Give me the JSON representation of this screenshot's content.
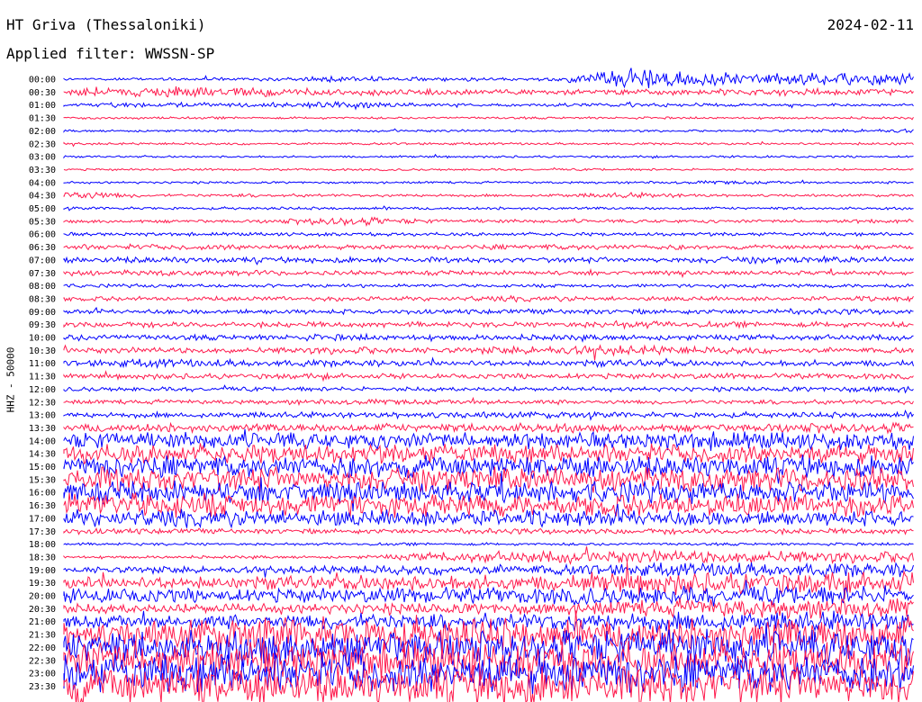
{
  "header": {
    "station_title": "HT Griva (Thessaloniki)",
    "date": "2024-02-11",
    "filter_label": "Applied filter:",
    "filter_value": "WWSSN-SP"
  },
  "channel_label": "HHZ - 50000",
  "colors": {
    "even_trace": "#0000ff",
    "odd_trace": "#ff1a4d",
    "background": "#ffffff",
    "text": "#000000"
  },
  "chart_data": {
    "type": "heatmap",
    "description_of_encoding": "helicorder: one trace row per 30 minutes; values are relative peak activity (0-1) along each row in 10 time segments",
    "ylabel": "HHZ - 50000",
    "row_labels": [
      "00:00",
      "00:30",
      "01:00",
      "01:30",
      "02:00",
      "02:30",
      "03:00",
      "03:30",
      "04:00",
      "04:30",
      "05:00",
      "05:30",
      "06:00",
      "06:30",
      "07:00",
      "07:30",
      "08:00",
      "08:30",
      "09:00",
      "09:30",
      "10:00",
      "10:30",
      "11:00",
      "11:30",
      "12:00",
      "12:30",
      "13:00",
      "13:30",
      "14:00",
      "14:30",
      "15:00",
      "15:30",
      "16:00",
      "16:30",
      "17:00",
      "17:30",
      "18:00",
      "18:30",
      "19:00",
      "19:30",
      "20:00",
      "20:30",
      "21:00",
      "21:30",
      "22:00",
      "22:30",
      "23:00",
      "23:30"
    ],
    "activity": [
      [
        0.15,
        0.15,
        0.2,
        0.3,
        0.25,
        0.2,
        0.7,
        0.5,
        0.5,
        0.5
      ],
      [
        0.4,
        0.45,
        0.4,
        0.35,
        0.3,
        0.3,
        0.3,
        0.35,
        0.35,
        0.3
      ],
      [
        0.2,
        0.3,
        0.25,
        0.4,
        0.15,
        0.15,
        0.3,
        0.2,
        0.15,
        0.15
      ],
      [
        0.1,
        0.1,
        0.1,
        0.1,
        0.1,
        0.1,
        0.1,
        0.1,
        0.1,
        0.1
      ],
      [
        0.1,
        0.1,
        0.1,
        0.1,
        0.1,
        0.1,
        0.1,
        0.1,
        0.15,
        0.25
      ],
      [
        0.1,
        0.1,
        0.1,
        0.1,
        0.1,
        0.1,
        0.1,
        0.1,
        0.1,
        0.2
      ],
      [
        0.08,
        0.08,
        0.08,
        0.08,
        0.08,
        0.08,
        0.08,
        0.08,
        0.08,
        0.08
      ],
      [
        0.08,
        0.08,
        0.08,
        0.08,
        0.08,
        0.08,
        0.1,
        0.08,
        0.08,
        0.08
      ],
      [
        0.1,
        0.1,
        0.1,
        0.1,
        0.1,
        0.1,
        0.1,
        0.2,
        0.1,
        0.1
      ],
      [
        0.5,
        0.15,
        0.2,
        0.15,
        0.15,
        0.15,
        0.3,
        0.15,
        0.15,
        0.15
      ],
      [
        0.15,
        0.15,
        0.15,
        0.15,
        0.15,
        0.15,
        0.15,
        0.15,
        0.15,
        0.15
      ],
      [
        0.2,
        0.2,
        0.2,
        0.45,
        0.2,
        0.2,
        0.2,
        0.2,
        0.2,
        0.25
      ],
      [
        0.2,
        0.2,
        0.2,
        0.2,
        0.2,
        0.2,
        0.2,
        0.2,
        0.2,
        0.2
      ],
      [
        0.3,
        0.3,
        0.3,
        0.25,
        0.25,
        0.3,
        0.3,
        0.25,
        0.25,
        0.25
      ],
      [
        0.3,
        0.35,
        0.3,
        0.3,
        0.3,
        0.3,
        0.3,
        0.35,
        0.35,
        0.3
      ],
      [
        0.3,
        0.3,
        0.3,
        0.25,
        0.25,
        0.25,
        0.25,
        0.25,
        0.25,
        0.25
      ],
      [
        0.2,
        0.2,
        0.2,
        0.2,
        0.2,
        0.2,
        0.2,
        0.2,
        0.2,
        0.25
      ],
      [
        0.25,
        0.25,
        0.25,
        0.25,
        0.25,
        0.3,
        0.25,
        0.25,
        0.25,
        0.3
      ],
      [
        0.25,
        0.25,
        0.25,
        0.25,
        0.25,
        0.3,
        0.3,
        0.3,
        0.3,
        0.3
      ],
      [
        0.3,
        0.3,
        0.3,
        0.3,
        0.3,
        0.3,
        0.4,
        0.3,
        0.3,
        0.3
      ],
      [
        0.35,
        0.3,
        0.3,
        0.35,
        0.3,
        0.3,
        0.3,
        0.3,
        0.3,
        0.3
      ],
      [
        0.3,
        0.3,
        0.3,
        0.4,
        0.3,
        0.4,
        0.45,
        0.35,
        0.3,
        0.3
      ],
      [
        0.3,
        0.4,
        0.35,
        0.35,
        0.3,
        0.3,
        0.4,
        0.3,
        0.35,
        0.35
      ],
      [
        0.25,
        0.3,
        0.3,
        0.3,
        0.25,
        0.3,
        0.3,
        0.3,
        0.3,
        0.3
      ],
      [
        0.25,
        0.25,
        0.25,
        0.25,
        0.25,
        0.25,
        0.25,
        0.25,
        0.3,
        0.35
      ],
      [
        0.25,
        0.25,
        0.25,
        0.3,
        0.25,
        0.25,
        0.25,
        0.25,
        0.25,
        0.25
      ],
      [
        0.3,
        0.3,
        0.3,
        0.3,
        0.35,
        0.35,
        0.3,
        0.3,
        0.3,
        0.3
      ],
      [
        0.4,
        0.4,
        0.4,
        0.4,
        0.4,
        0.45,
        0.4,
        0.4,
        0.45,
        0.45
      ],
      [
        0.6,
        0.6,
        0.6,
        0.6,
        0.6,
        0.6,
        0.6,
        0.65,
        0.6,
        0.6
      ],
      [
        0.65,
        0.65,
        0.65,
        0.65,
        0.65,
        0.65,
        0.65,
        0.65,
        0.65,
        0.65
      ],
      [
        0.7,
        0.7,
        0.7,
        0.7,
        0.7,
        0.7,
        0.7,
        0.7,
        0.7,
        0.7
      ],
      [
        0.75,
        0.75,
        0.75,
        0.75,
        0.75,
        0.75,
        0.75,
        0.75,
        0.75,
        0.75
      ],
      [
        0.7,
        0.7,
        0.7,
        0.7,
        0.7,
        0.7,
        0.7,
        0.7,
        0.7,
        0.7
      ],
      [
        0.75,
        0.8,
        0.7,
        0.7,
        0.7,
        0.7,
        0.7,
        0.7,
        0.7,
        0.7
      ],
      [
        0.6,
        0.6,
        0.6,
        0.6,
        0.6,
        0.6,
        0.6,
        0.55,
        0.55,
        0.55
      ],
      [
        0.3,
        0.3,
        0.3,
        0.3,
        0.3,
        0.3,
        0.3,
        0.3,
        0.3,
        0.3
      ],
      [
        0.15,
        0.15,
        0.15,
        0.15,
        0.15,
        0.15,
        0.15,
        0.15,
        0.15,
        0.15
      ],
      [
        0.15,
        0.15,
        0.15,
        0.15,
        0.45,
        0.5,
        0.5,
        0.5,
        0.5,
        0.5
      ],
      [
        0.35,
        0.35,
        0.35,
        0.4,
        0.45,
        0.45,
        0.5,
        0.55,
        0.55,
        0.55
      ],
      [
        0.5,
        0.5,
        0.55,
        0.6,
        0.6,
        0.6,
        0.7,
        0.7,
        0.7,
        0.7
      ],
      [
        0.55,
        0.55,
        0.55,
        0.55,
        0.6,
        0.6,
        0.65,
        0.65,
        0.65,
        0.65
      ],
      [
        0.45,
        0.45,
        0.45,
        0.45,
        0.5,
        0.5,
        0.6,
        0.65,
        0.65,
        0.65
      ],
      [
        0.5,
        0.5,
        0.55,
        0.6,
        0.6,
        0.6,
        0.65,
        0.65,
        0.65,
        0.7
      ],
      [
        0.8,
        0.85,
        0.9,
        0.9,
        0.9,
        0.85,
        0.85,
        0.85,
        0.9,
        0.9
      ],
      [
        0.9,
        0.9,
        0.95,
        0.95,
        0.95,
        0.9,
        0.9,
        0.9,
        0.9,
        0.95
      ],
      [
        0.95,
        0.95,
        0.95,
        0.95,
        0.95,
        0.95,
        0.95,
        0.95,
        0.95,
        0.95
      ],
      [
        0.95,
        0.95,
        0.95,
        0.95,
        0.95,
        0.95,
        0.95,
        0.95,
        0.95,
        0.95
      ],
      [
        0.95,
        0.95,
        0.95,
        0.95,
        0.95,
        0.95,
        0.95,
        0.95,
        0.95,
        0.95
      ]
    ]
  }
}
